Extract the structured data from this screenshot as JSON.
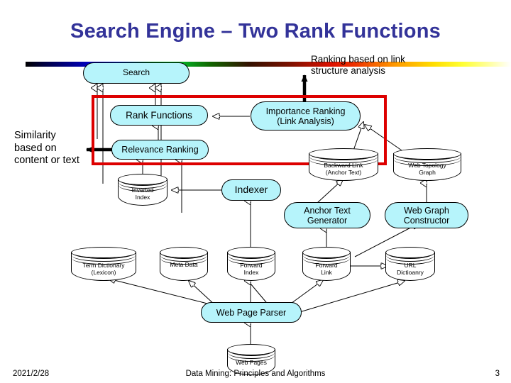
{
  "slide": {
    "title": "Search Engine – Two Rank Functions",
    "page_number": "3"
  },
  "footer": {
    "date": "2021/2/28",
    "title": "Data Mining: Principles and Algorithms",
    "page": "3"
  },
  "annotations": {
    "similarity": "Similarity based on content or text",
    "link_ranking": "Ranking based on link structure analysis"
  },
  "colors": {
    "title": "#333399",
    "node_fill": "#b6f4fb",
    "node_stroke": "#000000",
    "highlight_frame": "#dd0000",
    "connector": "#000000"
  },
  "nodes": {
    "process": [
      {
        "id": "search",
        "label": "Search"
      },
      {
        "id": "rank_functions",
        "label": "Rank Functions"
      },
      {
        "id": "importance_rank",
        "label": "Importance Ranking\n(Link Analysis)"
      },
      {
        "id": "relevance_rank",
        "label": "Relevance Ranking"
      },
      {
        "id": "indexer",
        "label": "Indexer"
      },
      {
        "id": "anchor_text_gen",
        "label": "Anchor Text\nGenerator"
      },
      {
        "id": "web_graph_constr",
        "label": "Web Graph\nConstructor"
      },
      {
        "id": "web_page_parser",
        "label": "Web Page Parser"
      }
    ],
    "datastore": [
      {
        "id": "inverted_index",
        "label": "Inverted\nIndex"
      },
      {
        "id": "backward_link",
        "label": "Backward Link\n(Anchor Text)"
      },
      {
        "id": "web_topology",
        "label": "Web Topology\nGraph"
      },
      {
        "id": "term_dictionary",
        "label": "Term Dictionary\n(Lexicon)"
      },
      {
        "id": "meta_data",
        "label": "Meta Data"
      },
      {
        "id": "forward_index",
        "label": "Forward\nIndex"
      },
      {
        "id": "forward_link",
        "label": "Forward\nLink"
      },
      {
        "id": "url_dictionary",
        "label": "URL\nDictioanry"
      },
      {
        "id": "web_pages",
        "label": "Web Pages"
      }
    ]
  },
  "labels": {
    "search": "Search",
    "rank_functions": "Rank Functions",
    "importance_ranking_l1": "Importance Ranking",
    "importance_ranking_l2": "(Link Analysis)",
    "relevance_ranking": "Relevance Ranking",
    "indexer": "Indexer",
    "anchor_text_generator_l1": "Anchor Text",
    "anchor_text_generator_l2": "Generator",
    "web_graph_constructor_l1": "Web Graph",
    "web_graph_constructor_l2": "Constructor",
    "web_page_parser": "Web Page Parser",
    "inverted_index_l1": "Inverted",
    "inverted_index_l2": "Index",
    "backward_link_l1": "Backward Link",
    "backward_link_l2": "(Anchor Text)",
    "web_topology_l1": "Web Topology",
    "web_topology_l2": "Graph",
    "term_dictionary_l1": "Term Dictionary",
    "term_dictionary_l2": "(Lexicon)",
    "meta_data": "Meta Data",
    "forward_index_l1": "Forward",
    "forward_index_l2": "Index",
    "forward_link_l1": "Forward",
    "forward_link_l2": "Link",
    "url_dictionary_l1": "URL",
    "url_dictionary_l2": "Dictioanry",
    "web_pages": "Web Pages",
    "similarity_l1": "Similarity",
    "similarity_l2": "based on",
    "similarity_l3": "content or text",
    "link_rank_l1": "Ranking based on link",
    "link_rank_l2": "structure analysis"
  }
}
